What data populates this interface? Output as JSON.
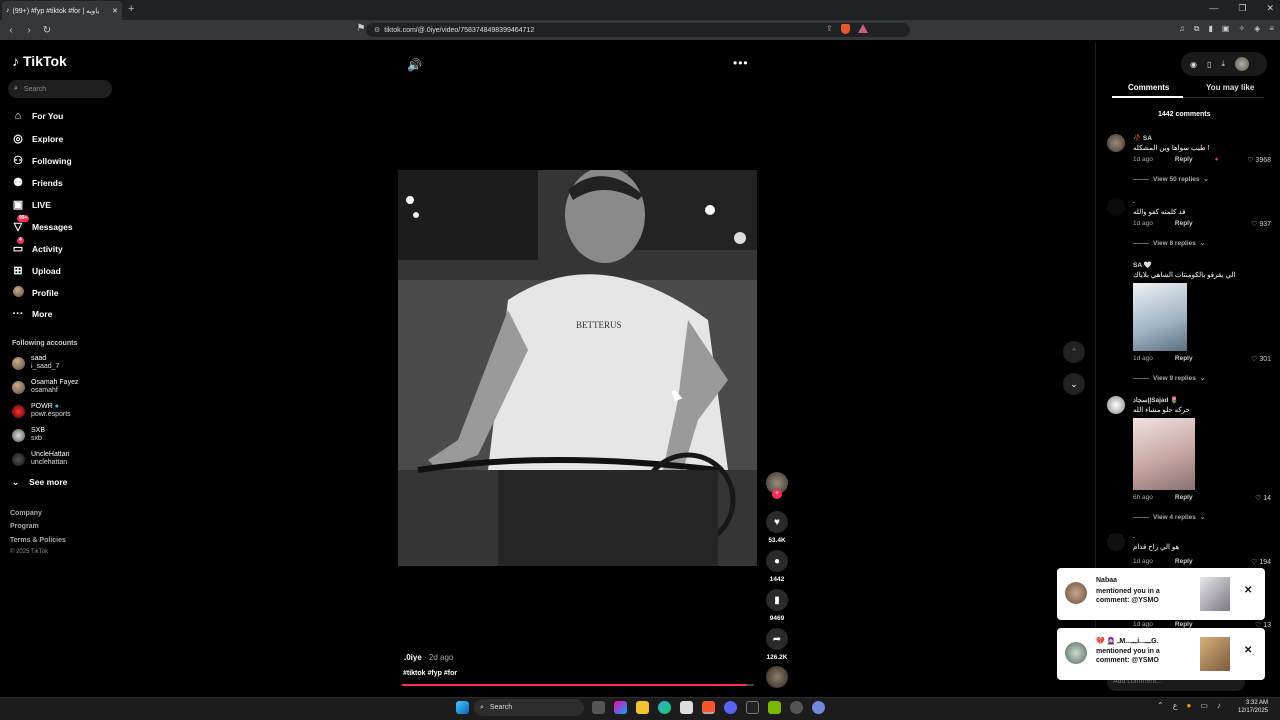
{
  "browser": {
    "tab_title": "(99+) #fyp #tiktok #for | ياويه",
    "url": "tiktok.com/@.0iye/video/7583748498399464712",
    "new_tab_label": "+"
  },
  "sidebar": {
    "brand": "TikTok",
    "search_placeholder": "Search",
    "nav": [
      {
        "label": "For You",
        "icon": "home-icon"
      },
      {
        "label": "Explore",
        "icon": "compass-icon"
      },
      {
        "label": "Following",
        "icon": "following-icon"
      },
      {
        "label": "Friends",
        "icon": "friends-icon"
      },
      {
        "label": "LIVE",
        "icon": "live-icon"
      },
      {
        "label": "Messages",
        "icon": "messages-icon",
        "badge": "99+"
      },
      {
        "label": "Activity",
        "icon": "activity-icon",
        "badge": "4"
      },
      {
        "label": "Upload",
        "icon": "upload-icon"
      },
      {
        "label": "Profile",
        "icon": "profile-avatar"
      },
      {
        "label": "More",
        "icon": "more-icon"
      }
    ],
    "following_title": "Following accounts",
    "accounts": [
      {
        "name": "saad",
        "handle": "i_saad_7"
      },
      {
        "name": "Osamah Fayez",
        "handle": "osamahf"
      },
      {
        "name": "POWR",
        "handle": "powr.esports"
      },
      {
        "name": "SXB",
        "handle": "sxb"
      },
      {
        "name": "UncleHattan",
        "handle": "unclehattan"
      }
    ],
    "see_more": "See more",
    "footer": [
      "Company",
      "Program",
      "Terms & Policies",
      "© 2025 TikTok"
    ]
  },
  "video": {
    "author": ".0iye",
    "posted": "· 2d ago",
    "caption": "#tiktok #fyp #for",
    "shirt_text": "BETTERUS",
    "progress": 0.98,
    "likes": "53.4K",
    "comments": "1442",
    "saves": "9469",
    "shares": "126.2K"
  },
  "panel": {
    "tab_comments": "Comments",
    "tab_like": "You may like",
    "count": "1442 comments",
    "reply_label": "Reply",
    "comments": [
      {
        "name": "🥀 SA",
        "text": "طيب سواها وين المشكله !",
        "time": "1d ago",
        "likes": "3968",
        "replies": "View 50 replies"
      },
      {
        "name": ".",
        "text": "قد كلمته كفو والله",
        "time": "1d ago",
        "likes": "937",
        "replies": "View 8 replies"
      },
      {
        "name": "SA 🤍",
        "text": "الي يقرفو بالكومنتات الشاهي بلاياك",
        "time": "1d ago",
        "likes": "301",
        "replies": "View 9 replies"
      },
      {
        "name": "سجاد||Sajad 🌷",
        "text": "حركه حلو مشاء الله",
        "time": "6h ago",
        "likes": "14",
        "replies": "View 4 replies"
      },
      {
        "name": ".",
        "text": "هو الي راح قدام",
        "time": "1d ago",
        "likes": "194",
        "replies": ""
      }
    ],
    "partial": {
      "time": "1d ago",
      "likes": "13"
    },
    "add_comment": "Add comment..."
  },
  "notifications": [
    {
      "name": "Nabaa",
      "message": "mentioned you in a comment: @YSMO"
    },
    {
      "name": "💔 🧕🏻 ـM...ـــi...ـــG.",
      "message": "mentioned you in a comment: @YSMO"
    }
  ],
  "taskbar": {
    "search": "Search",
    "lang": "ع",
    "time": "3:32 AM",
    "date": "12/17/2025"
  },
  "colors": {
    "accent": "#fe2c55",
    "bg": "#000000"
  }
}
